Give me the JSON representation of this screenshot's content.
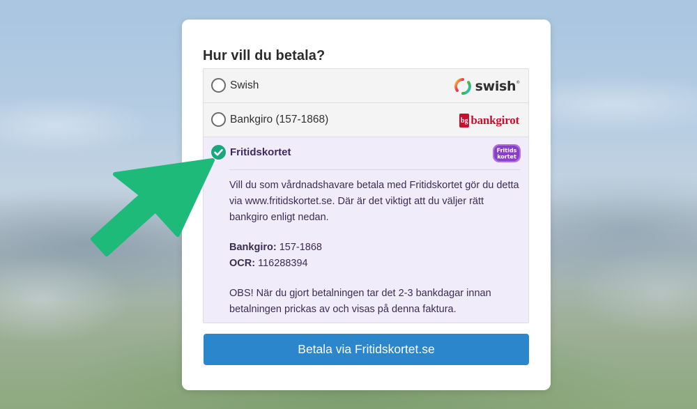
{
  "card": {
    "title": "Hur vill du betala?"
  },
  "options": [
    {
      "label": "Swish",
      "selected": false,
      "logo": {
        "name": "swish-logo",
        "text": "swish",
        "mark": "®"
      }
    },
    {
      "label": "Bankgiro (157-1868)",
      "selected": false,
      "logo": {
        "name": "bankgirot-logo",
        "text": "bankgirot",
        "mark": "bg"
      }
    },
    {
      "label": "Fritidskortet",
      "selected": true,
      "logo": {
        "name": "fritidskortet-logo",
        "text": "Fritids kortet"
      }
    }
  ],
  "fritid_details": {
    "intro": "Vill du som vårdnadshavare betala med Fritidskortet gör du detta via www.fritidskortet.se. Där är det viktigt att du väljer rätt bankgiro enligt nedan.",
    "bankgiro_label": "Bankgiro:",
    "bankgiro_value": "157-1868",
    "ocr_label": "OCR:",
    "ocr_value": "116288394",
    "note": "OBS! När du gjort betalningen tar det 2-3 bankdagar innan betalningen prickas av och visas på denna faktura."
  },
  "pay_button": {
    "label": "Betala via Fritidskortet.se"
  },
  "colors": {
    "accent_green": "#1aa77b",
    "button_blue": "#2b86cc",
    "selected_bg": "#f1ecfa",
    "bankgirot_red": "#c8102e",
    "arrow_green": "#1dba7a"
  },
  "icons": {
    "arrow": "arrow-pointer-icon",
    "check": "check-icon"
  }
}
